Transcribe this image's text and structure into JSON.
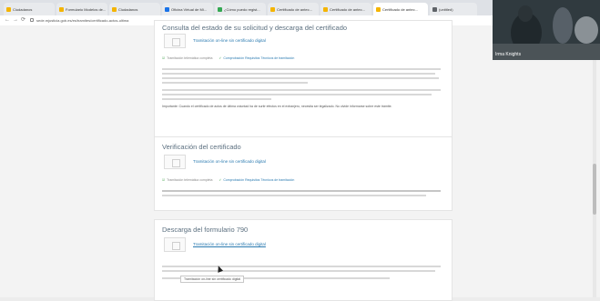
{
  "browser": {
    "tabs": [
      {
        "label": "Ciudadanos",
        "color": "#f4b400"
      },
      {
        "label": "Formulario Modelos de...",
        "color": "#f4b400"
      },
      {
        "label": "Ciudadanos",
        "color": "#f4b400"
      },
      {
        "label": "Oficina Virtual de Mi...",
        "color": "#1a73e8"
      },
      {
        "label": "¿Cómo puedo regist...",
        "color": "#34a853"
      },
      {
        "label": "Certificado de antec...",
        "color": "#f4b400"
      },
      {
        "label": "Certificado de antec...",
        "color": "#f4b400"
      },
      {
        "label": "Certificado de antec...",
        "color": "#f4b400"
      },
      {
        "label": "(untitled)",
        "color": "#5f6368"
      }
    ],
    "url": "sede.mjusticia.gob.es/es/tramites/certificado-actos-ultima",
    "back_glyph": "←",
    "forward_glyph": "→",
    "reload_glyph": "⟳",
    "icon": "lock-icon"
  },
  "sections": [
    {
      "title": "Consulta del estado de su solicitud y descarga del certificado",
      "link": "Tramitación on-line sin certificado digital",
      "meta_a": "Tramitación telemática completa",
      "meta_b": "Comprobación Requisitos Técnicos de tramitación",
      "note": "Importante: Cuando el certificado de actos de última voluntad ha de surtir efectos en el extranjero, necesita ser legalizado. No olvide informarse sobre este trámite."
    },
    {
      "title": "Verificación del certificado",
      "link": "Tramitación on-line sin certificado digital",
      "meta_a": "Tramitación telemática completa",
      "meta_b": "Comprobación Requisitos Técnicos de tramitación"
    },
    {
      "title": "Descarga del formulario 790",
      "link": "Tramitación on-line sin certificado digital",
      "tooltip": "Tramitación on-line sin certificado digital"
    }
  ],
  "video": {
    "name": "Irma Knights",
    "icon": "video-feed-icon"
  },
  "colors": {
    "link": "#2a7ab0",
    "heading": "#5b6f7f",
    "ok": "#2e9a3a"
  }
}
